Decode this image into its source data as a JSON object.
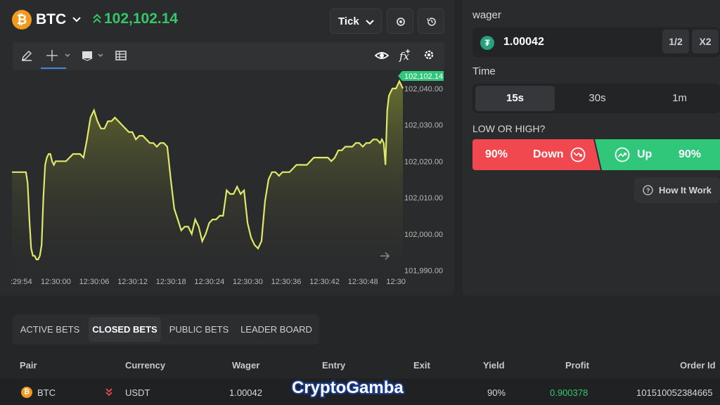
{
  "header": {
    "pair": "BTC",
    "price": "102,102.14",
    "chart_type": "Tick",
    "btc_glyph": "₿"
  },
  "chart": {
    "current_price_tag": "102,102.14",
    "y_ticks": [
      "102,040.00",
      "102,030.00",
      "102,020.00",
      "102,010.00",
      "102,000.00",
      "101,990.00"
    ],
    "x_ticks": [
      ":29:54",
      "12:30:00",
      "12:30:06",
      "12:30:12",
      "12:30:18",
      "12:30:24",
      "12:30:30",
      "12:30:36",
      "12:30:42",
      "12:30:48",
      "12:30"
    ],
    "line_color": "#dfe86a"
  },
  "chart_data": {
    "type": "area",
    "ylim": [
      101987,
      102045
    ],
    "x": [
      0,
      3,
      6,
      8,
      9,
      10,
      11,
      12,
      13,
      14,
      15,
      16,
      17,
      18,
      19,
      20,
      21,
      22,
      23,
      24,
      25,
      27,
      29,
      31,
      33,
      35,
      37,
      39,
      41,
      43,
      45,
      47,
      49,
      51,
      53,
      55,
      57,
      59,
      61,
      63,
      65,
      67,
      69,
      71,
      73,
      75,
      77,
      79,
      81,
      83,
      85,
      87,
      89,
      91,
      93,
      95,
      97,
      99,
      101,
      103,
      105,
      107,
      109,
      111,
      113,
      115,
      117,
      119,
      121,
      123,
      125,
      127,
      129,
      131,
      133,
      135,
      137,
      139,
      141,
      143,
      145,
      147,
      149,
      151,
      153,
      155,
      157,
      159,
      161,
      163,
      165,
      167,
      169,
      171,
      173,
      175,
      177,
      179,
      181,
      183,
      185,
      187,
      189,
      191,
      193,
      195,
      197,
      199,
      201,
      203,
      205,
      207,
      209,
      211,
      212,
      213,
      214,
      215,
      216,
      217,
      218,
      219,
      220,
      221,
      222,
      223,
      224
    ],
    "y": [
      102017,
      102017,
      102017,
      102017,
      102014,
      102004,
      101996,
      101994,
      101994,
      101993,
      101993,
      101994,
      101997,
      102010,
      102019,
      102021,
      102022,
      102022,
      102020,
      102019,
      102020,
      102020,
      102020,
      102020,
      102021,
      102022,
      102022,
      102022,
      102021,
      102026,
      102032,
      102034,
      102031,
      102029,
      102029,
      102031,
      102031,
      102032,
      102031,
      102030,
      102029,
      102028,
      102028,
      102026,
      102027,
      102027,
      102026,
      102025,
      102025,
      102024,
      102025,
      102025,
      102024,
      102015,
      102007,
      102004,
      102001,
      102002,
      102002,
      102000,
      102004,
      102002,
      101998,
      102000,
      102003,
      102004,
      102004,
      102005,
      102005,
      102012,
      102011,
      102011,
      102013,
      102011,
      102012,
      102003,
      101999,
      101997,
      101996,
      101998,
      102009,
      102015,
      102017,
      102017,
      102016,
      102017,
      102017,
      102017,
      102018,
      102019,
      102019,
      102019,
      102019,
      102020,
      102021,
      102021,
      102021,
      102021,
      102021,
      102020,
      102021,
      102023,
      102023,
      102024,
      102024,
      102024,
      102025,
      102025,
      102024,
      102025,
      102025,
      102026,
      102026,
      102025,
      102026,
      102025,
      102019,
      102034,
      102038,
      102039,
      102040,
      102040,
      102040,
      102041,
      102042,
      102041,
      102040,
      102041,
      102040,
      102040
    ]
  },
  "wager": {
    "label": "wager",
    "value": "1.00042",
    "currency_glyph": "₮",
    "half_label": "1/2",
    "double_label": "X2"
  },
  "time": {
    "label": "Time",
    "options": [
      "15s",
      "30s",
      "1m"
    ],
    "selected": "15s"
  },
  "low_high": {
    "label": "LOW OR HIGH?",
    "down_pct": "90%",
    "down_label": "Down",
    "up_label": "Up",
    "up_pct": "90%"
  },
  "how_it_work": "How It Work",
  "bets": {
    "tabs": [
      "ACTIVE BETS",
      "CLOSED BETS",
      "PUBLIC BETS",
      "LEADER BOARD"
    ],
    "active_tab": "CLOSED BETS",
    "columns": [
      "Pair",
      "Currency",
      "Wager",
      "Entry",
      "Exit",
      "Yield",
      "Profit",
      "Order Id"
    ],
    "rows": [
      {
        "pair": "BTC",
        "currency": "USDT",
        "wager": "1.00042",
        "entry": "",
        "exit": "",
        "yield": "90%",
        "profit": "0.900378",
        "order_id": "101510052384665"
      }
    ]
  },
  "watermark": "CryptoGamba",
  "colors": {
    "up": "#30c77b",
    "down": "#f0484e",
    "price_up": "#32c86a",
    "accent": "#3d8bd8",
    "btc": "#f39a1e",
    "usdt": "#26a17b"
  }
}
